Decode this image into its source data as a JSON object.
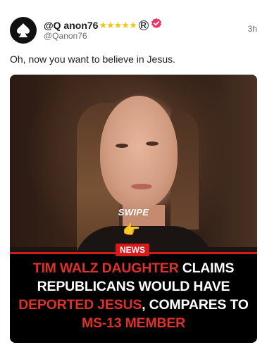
{
  "post": {
    "display_name": "@Q anon76",
    "badge_stars": "★★★★★",
    "registered_mark": "R",
    "handle": "@Qanon76",
    "timestamp": "3h",
    "text": "Oh, now you want to believe in Jesus."
  },
  "media": {
    "swipe_label": "SWIPE",
    "hand_emoji": "👉",
    "news_badge": "NEWS",
    "headline": {
      "part1": "TIM WALZ DAUGHTER",
      "part2": " CLAIMS REPUBLICANS WOULD HAVE ",
      "part3": "DEPORTED JESUS",
      "part4": ", COMPARES TO ",
      "part5": "MS-13 MEMBER"
    }
  },
  "colors": {
    "verified": "#ee3366",
    "stars": "#f5c518",
    "headline_red": "#e0302c",
    "news_red": "#d61a1a"
  },
  "icons": {
    "avatar": "spade-skull-avatar-icon",
    "verified": "verified-check-icon"
  }
}
